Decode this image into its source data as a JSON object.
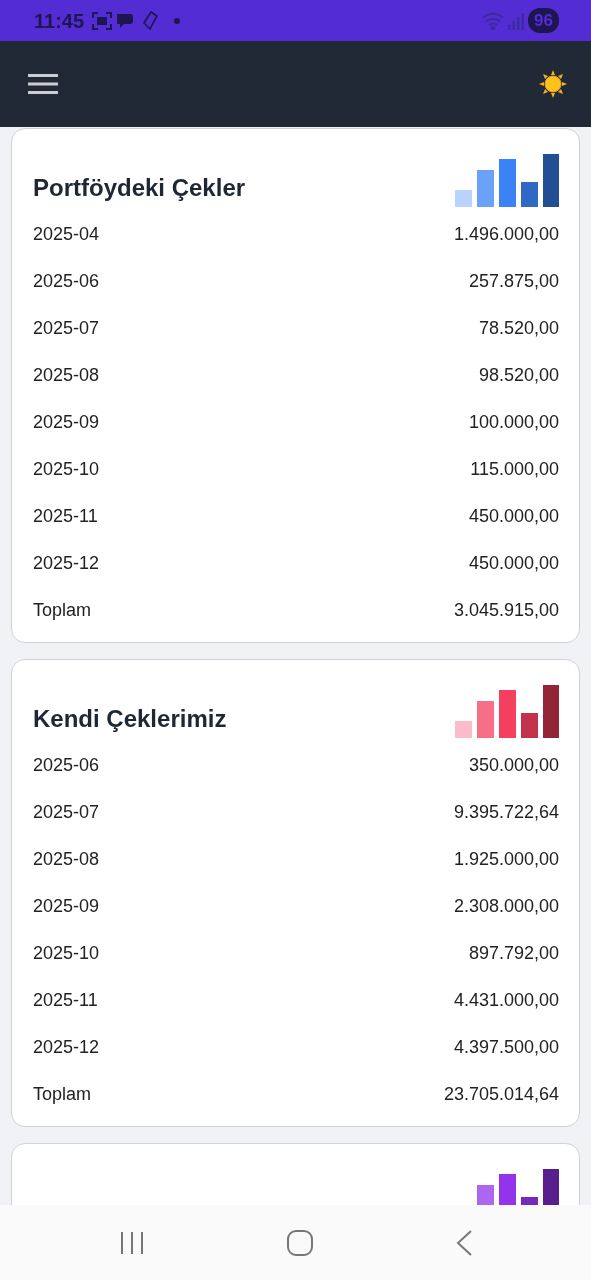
{
  "status_bar": {
    "time": "11:45",
    "battery": "96"
  },
  "cards": [
    {
      "title": "Portföydeki Çekler",
      "color": "#3b82f6",
      "rows": [
        {
          "label": "2025-04",
          "value": "1.496.000,00"
        },
        {
          "label": "2025-06",
          "value": "257.875,00"
        },
        {
          "label": "2025-07",
          "value": "78.520,00"
        },
        {
          "label": "2025-08",
          "value": "98.520,00"
        },
        {
          "label": "2025-09",
          "value": "100.000,00"
        },
        {
          "label": "2025-10",
          "value": "115.000,00"
        },
        {
          "label": "2025-11",
          "value": "450.000,00"
        },
        {
          "label": "2025-12",
          "value": "450.000,00"
        },
        {
          "label": "Toplam",
          "value": "3.045.915,00"
        }
      ]
    },
    {
      "title": "Kendi Çeklerimiz",
      "color": "#f43f5e",
      "rows": [
        {
          "label": "2025-06",
          "value": "350.000,00"
        },
        {
          "label": "2025-07",
          "value": "9.395.722,64"
        },
        {
          "label": "2025-08",
          "value": "1.925.000,00"
        },
        {
          "label": "2025-09",
          "value": "2.308.000,00"
        },
        {
          "label": "2025-10",
          "value": "897.792,00"
        },
        {
          "label": "2025-11",
          "value": "4.431.000,00"
        },
        {
          "label": "2025-12",
          "value": "4.397.500,00"
        },
        {
          "label": "Toplam",
          "value": "23.705.014,64"
        }
      ]
    },
    {
      "color": "#9333ea"
    }
  ]
}
